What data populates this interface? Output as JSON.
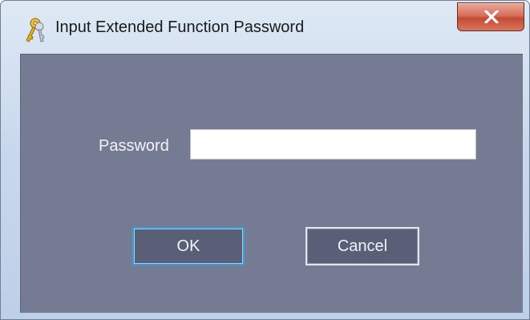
{
  "window": {
    "title": "Input Extended Function Password",
    "close_label": "Close"
  },
  "form": {
    "password_label": "Password",
    "password_value": "",
    "ok_label": "OK",
    "cancel_label": "Cancel"
  },
  "icons": {
    "title_icon": "keys-icon",
    "close_icon": "close-icon"
  },
  "colors": {
    "client_background": "#757b93",
    "button_background": "#5a5f78",
    "ok_focus_border": "#3f9bd8",
    "close_button": "#c44a33"
  }
}
